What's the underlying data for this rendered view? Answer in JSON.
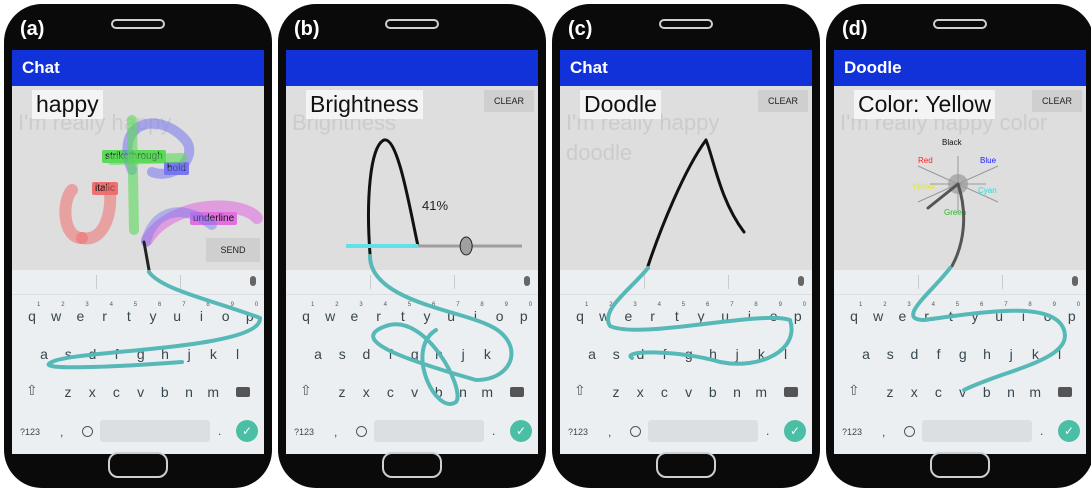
{
  "panels": [
    {
      "label": "(a)",
      "appbar_title": "Chat",
      "command": "happy",
      "faded_text": "I'm really happy",
      "faded_text2": "",
      "clear": "",
      "send": "SEND",
      "tags": {
        "strikethrough": "strikethrough",
        "bold": "bold",
        "italic": "italic",
        "underline": "underline"
      },
      "tag_colors": {
        "strikethrough": "#5ad95a",
        "bold": "#7777f0",
        "italic": "#ee7070",
        "underline": "#e070e0"
      }
    },
    {
      "label": "(b)",
      "appbar_title": "",
      "command": "Brightness",
      "faded_text": "Brightness",
      "faded_text2": "",
      "clear": "CLEAR",
      "send": "",
      "slider_value": "41%",
      "slider_fraction": 0.41
    },
    {
      "label": "(c)",
      "appbar_title": "Chat",
      "command": "Doodle",
      "faded_text": "I'm really happy",
      "faded_text2": "doodle",
      "clear": "CLEAR",
      "send": ""
    },
    {
      "label": "(d)",
      "appbar_title": "Doodle",
      "command": "Color: Yellow",
      "faded_text": "I'm really happy color",
      "faded_text2": "",
      "clear": "CLEAR",
      "send": "",
      "colors": {
        "black": "Black",
        "red": "Red",
        "blue": "Blue",
        "yellow": "Yellow",
        "cyan": "Cyan",
        "green": "Green"
      },
      "color_values": {
        "black": "#111111",
        "red": "#ff2020",
        "blue": "#2020ff",
        "yellow": "#e8e820",
        "cyan": "#20e0e0",
        "green": "#20c020"
      }
    }
  ],
  "keyboard": {
    "row1": [
      "q",
      "w",
      "e",
      "r",
      "t",
      "y",
      "u",
      "i",
      "o",
      "p"
    ],
    "row1_hints": [
      "1",
      "2",
      "3",
      "4",
      "5",
      "6",
      "7",
      "8",
      "9",
      "0"
    ],
    "row2": [
      "a",
      "s",
      "d",
      "f",
      "g",
      "h",
      "j",
      "k",
      "l"
    ],
    "row3": [
      "z",
      "x",
      "c",
      "v",
      "b",
      "n",
      "m"
    ],
    "sym_key": "?123",
    "comma_key": ",",
    "period_key": ".",
    "enter_glyph": "✓",
    "shift_glyph": "⇧"
  },
  "accent_colors": {
    "appbar": "#1032d8",
    "gesture_trail": "#57b8b8",
    "enter_key": "#4bbfa5"
  }
}
